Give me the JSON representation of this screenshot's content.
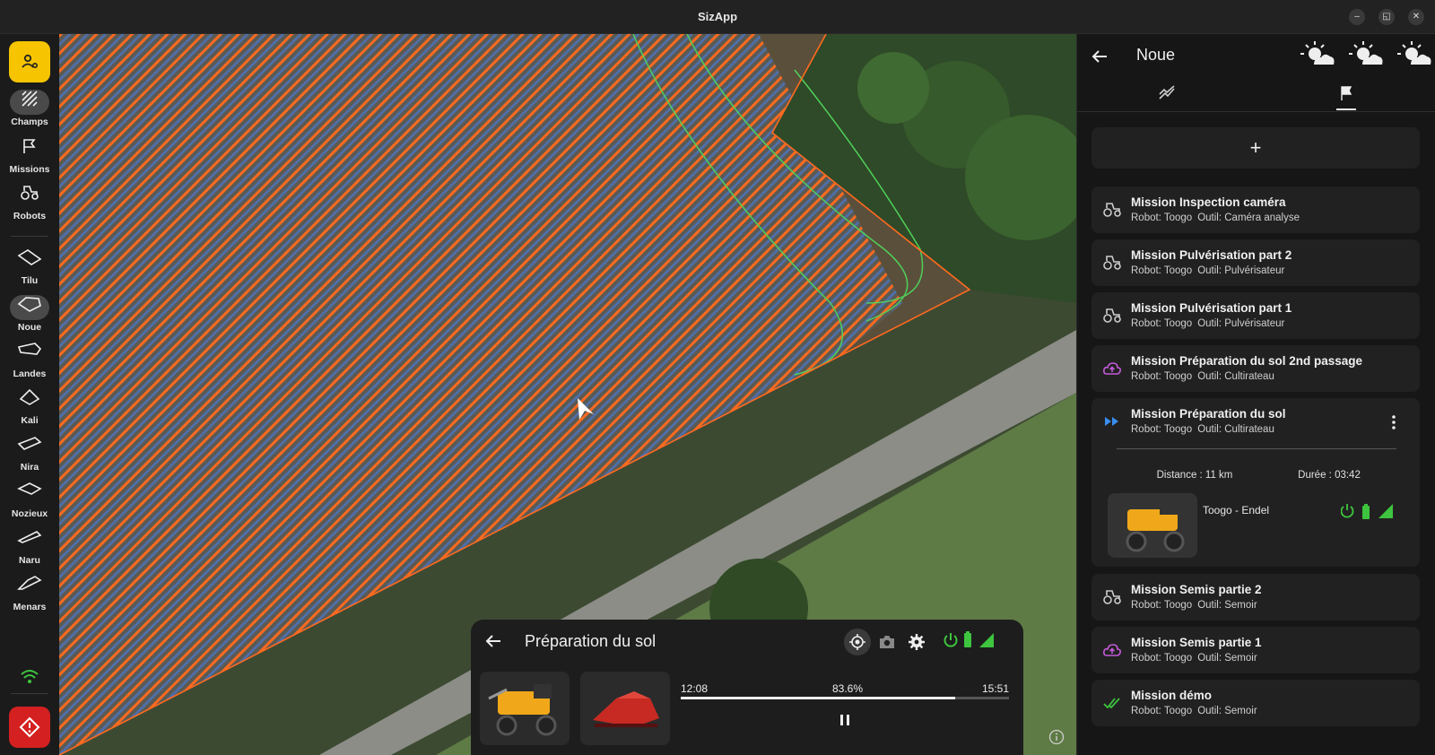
{
  "window": {
    "title": "SizApp",
    "controls": [
      "–",
      "◱",
      "✕"
    ]
  },
  "sidebar": {
    "top": [
      {
        "id": "champs",
        "label": "Champs",
        "icon": "hatch-icon",
        "active": true
      },
      {
        "id": "missions",
        "label": "Missions",
        "icon": "flag-icon"
      },
      {
        "id": "robots",
        "label": "Robots",
        "icon": "tractor-icon"
      }
    ],
    "fields": [
      {
        "id": "tilu",
        "label": "Tilu"
      },
      {
        "id": "noue",
        "label": "Noue",
        "active": true
      },
      {
        "id": "landes",
        "label": "Landes"
      },
      {
        "id": "kali",
        "label": "Kali"
      },
      {
        "id": "nira",
        "label": "Nira"
      },
      {
        "id": "nozieux",
        "label": "Nozieux"
      },
      {
        "id": "naru",
        "label": "Naru"
      },
      {
        "id": "menars",
        "label": "Menars"
      }
    ]
  },
  "mission_panel": {
    "title": "Préparation du sol",
    "start_time": "12:08",
    "progress_label": "83.6%",
    "progress": 0.836,
    "end_time": "15:51"
  },
  "right_panel": {
    "title": "Noue",
    "add_label": "+",
    "missions": [
      {
        "title": "Mission Inspection caméra",
        "robot": "Robot: Toogo",
        "tool": "Outil: Caméra analyse",
        "status": "tractor"
      },
      {
        "title": "Mission Pulvérisation part 2",
        "robot": "Robot: Toogo",
        "tool": "Outil: Pulvérisateur",
        "status": "tractor"
      },
      {
        "title": "Mission Pulvérisation part 1",
        "robot": "Robot: Toogo",
        "tool": "Outil: Pulvérisateur",
        "status": "tractor"
      },
      {
        "title": "Mission Préparation du sol 2nd passage",
        "robot": "Robot: Toogo",
        "tool": "Outil: Cultirateau",
        "status": "cloud-upload"
      },
      {
        "title": "Mission Préparation du sol",
        "robot": "Robot: Toogo",
        "tool": "Outil: Cultirateau",
        "status": "running"
      },
      {
        "title": "Mission Semis partie 2",
        "robot": "Robot: Toogo",
        "tool": "Outil: Semoir",
        "status": "tractor"
      },
      {
        "title": "Mission Semis partie 1",
        "robot": "Robot: Toogo",
        "tool": "Outil: Semoir",
        "status": "cloud-upload"
      },
      {
        "title": "Mission démo",
        "robot": "Robot: Toogo",
        "tool": "Outil: Semoir",
        "status": "done"
      }
    ],
    "expanded": {
      "distance": "Distance : 11 km",
      "duration": "Durée : 03:42",
      "robot_name": "Toogo - Endel"
    }
  },
  "colors": {
    "accent_yellow": "#f6c400",
    "emergency_red": "#d42020",
    "path_orange": "#ff6a1f",
    "path_green": "#4fd05a",
    "status_green": "#3ec43e",
    "cloud_purple": "#c25ad8",
    "running_blue": "#3a8ef0"
  }
}
